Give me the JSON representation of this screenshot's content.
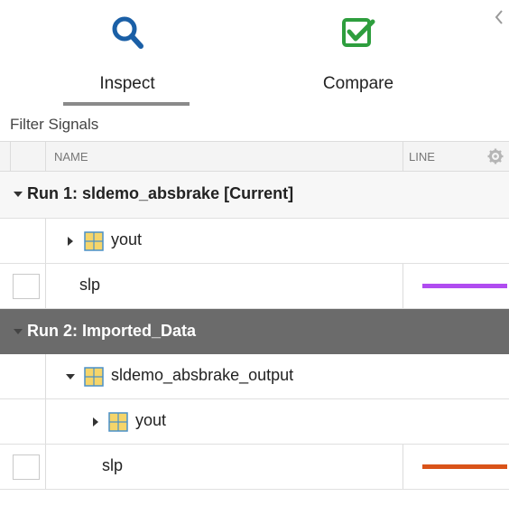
{
  "toolbar": {
    "inspect_label": "Inspect",
    "compare_label": "Compare",
    "active_mode": "Inspect"
  },
  "filter": {
    "placeholder": "Filter Signals"
  },
  "table": {
    "col_name": "NAME",
    "col_line": "LINE"
  },
  "runs": [
    {
      "label": "Run 1: sldemo_absbrake [Current]",
      "items": [
        {
          "label": "yout",
          "type": "group",
          "expanded": false
        },
        {
          "label": "slp",
          "type": "signal",
          "checked": false,
          "line_color": "#b04cf0"
        }
      ]
    },
    {
      "label": "Run 2: Imported_Data",
      "selected": true,
      "items": [
        {
          "label": "sldemo_absbrake_output",
          "type": "group",
          "expanded": true
        },
        {
          "label": "yout",
          "type": "group",
          "expanded": false
        },
        {
          "label": "slp",
          "type": "signal",
          "checked": false,
          "line_color": "#d95319"
        }
      ]
    }
  ],
  "colors": {
    "inspect_icon": "#1a5fa6",
    "compare_icon": "#2e9e3e",
    "selected_run_bg": "#6b6b6b",
    "grid_icon_fill": "#f5d56a",
    "grid_icon_border": "#4a90c8"
  }
}
